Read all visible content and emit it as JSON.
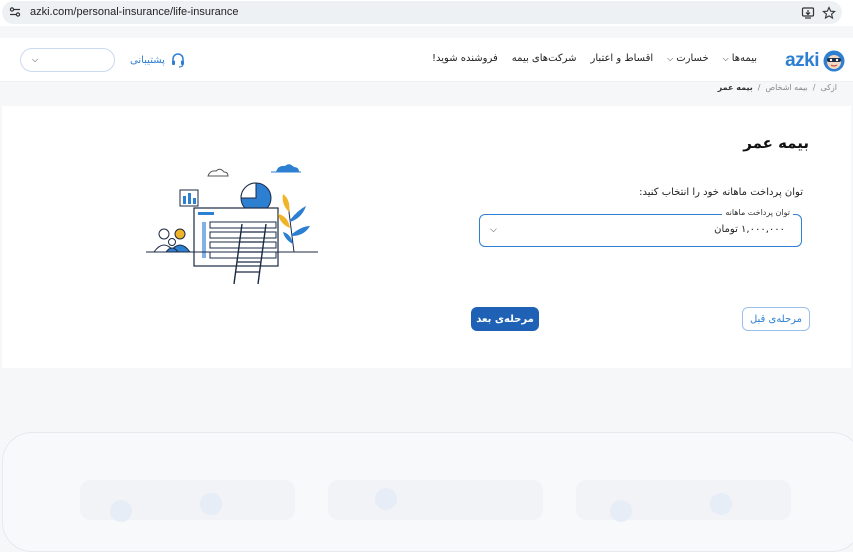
{
  "browser": {
    "url": "azki.com/personal-insurance/life-insurance",
    "left_icon": "site-settings-icon",
    "right_icons": [
      "install-app-icon",
      "bookmark-star-icon"
    ]
  },
  "nav": {
    "brand": "azki",
    "menu": [
      {
        "label": "بیمه‌ها",
        "has_dropdown": true
      },
      {
        "label": "خسارت",
        "has_dropdown": true
      },
      {
        "label": "اقساط و اعتبار",
        "has_dropdown": false
      },
      {
        "label": "شرکت‌های بیمه",
        "has_dropdown": false
      },
      {
        "label": "فروشنده شوید!",
        "has_dropdown": false
      }
    ],
    "support_label": "پشتیبانی",
    "support_icon": "headset-icon",
    "account_select_value": ""
  },
  "breadcrumb": {
    "items": [
      "ازکی",
      "بیمه اشخاص",
      "بیمه عمر"
    ],
    "separator": "/"
  },
  "form": {
    "title": "بیمه عمر",
    "prompt": "توان پرداخت ماهانه خود را انتخاب کنید:",
    "field_label": "توان پرداخت ماهانه",
    "field_value": "۱,۰۰۰,۰۰۰ تومان",
    "prev_label": "مرحله‌ی قبل",
    "next_label": "مرحله‌ی بعد"
  },
  "colors": {
    "accent": "#2d7fd1",
    "primary_button": "#1f62b5",
    "background": "#f6f7f9"
  }
}
